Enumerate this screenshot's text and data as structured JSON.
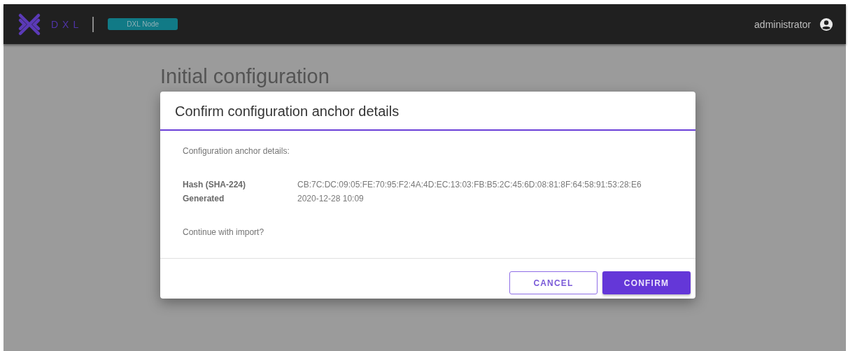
{
  "header": {
    "logo_text": "DXL",
    "node_badge": "DXL Node",
    "user": "administrator"
  },
  "page": {
    "title": "Initial configuration"
  },
  "dialog": {
    "title": "Confirm configuration anchor details",
    "intro": "Configuration anchor details:",
    "details": [
      {
        "label": "Hash (SHA-224)",
        "value": "CB:7C:DC:09:05:FE:70:95:F2:4A:4D:EC:13:03:FB:B5:2C:45:6D:08:81:8F:64:58:91:53:28:E6"
      },
      {
        "label": "Generated",
        "value": "2020-12-28 10:09"
      }
    ],
    "question": "Continue with import?",
    "buttons": [
      {
        "label": "CANCEL",
        "kind": "outlined"
      },
      {
        "label": "CONFIRM",
        "kind": "filled"
      }
    ]
  }
}
